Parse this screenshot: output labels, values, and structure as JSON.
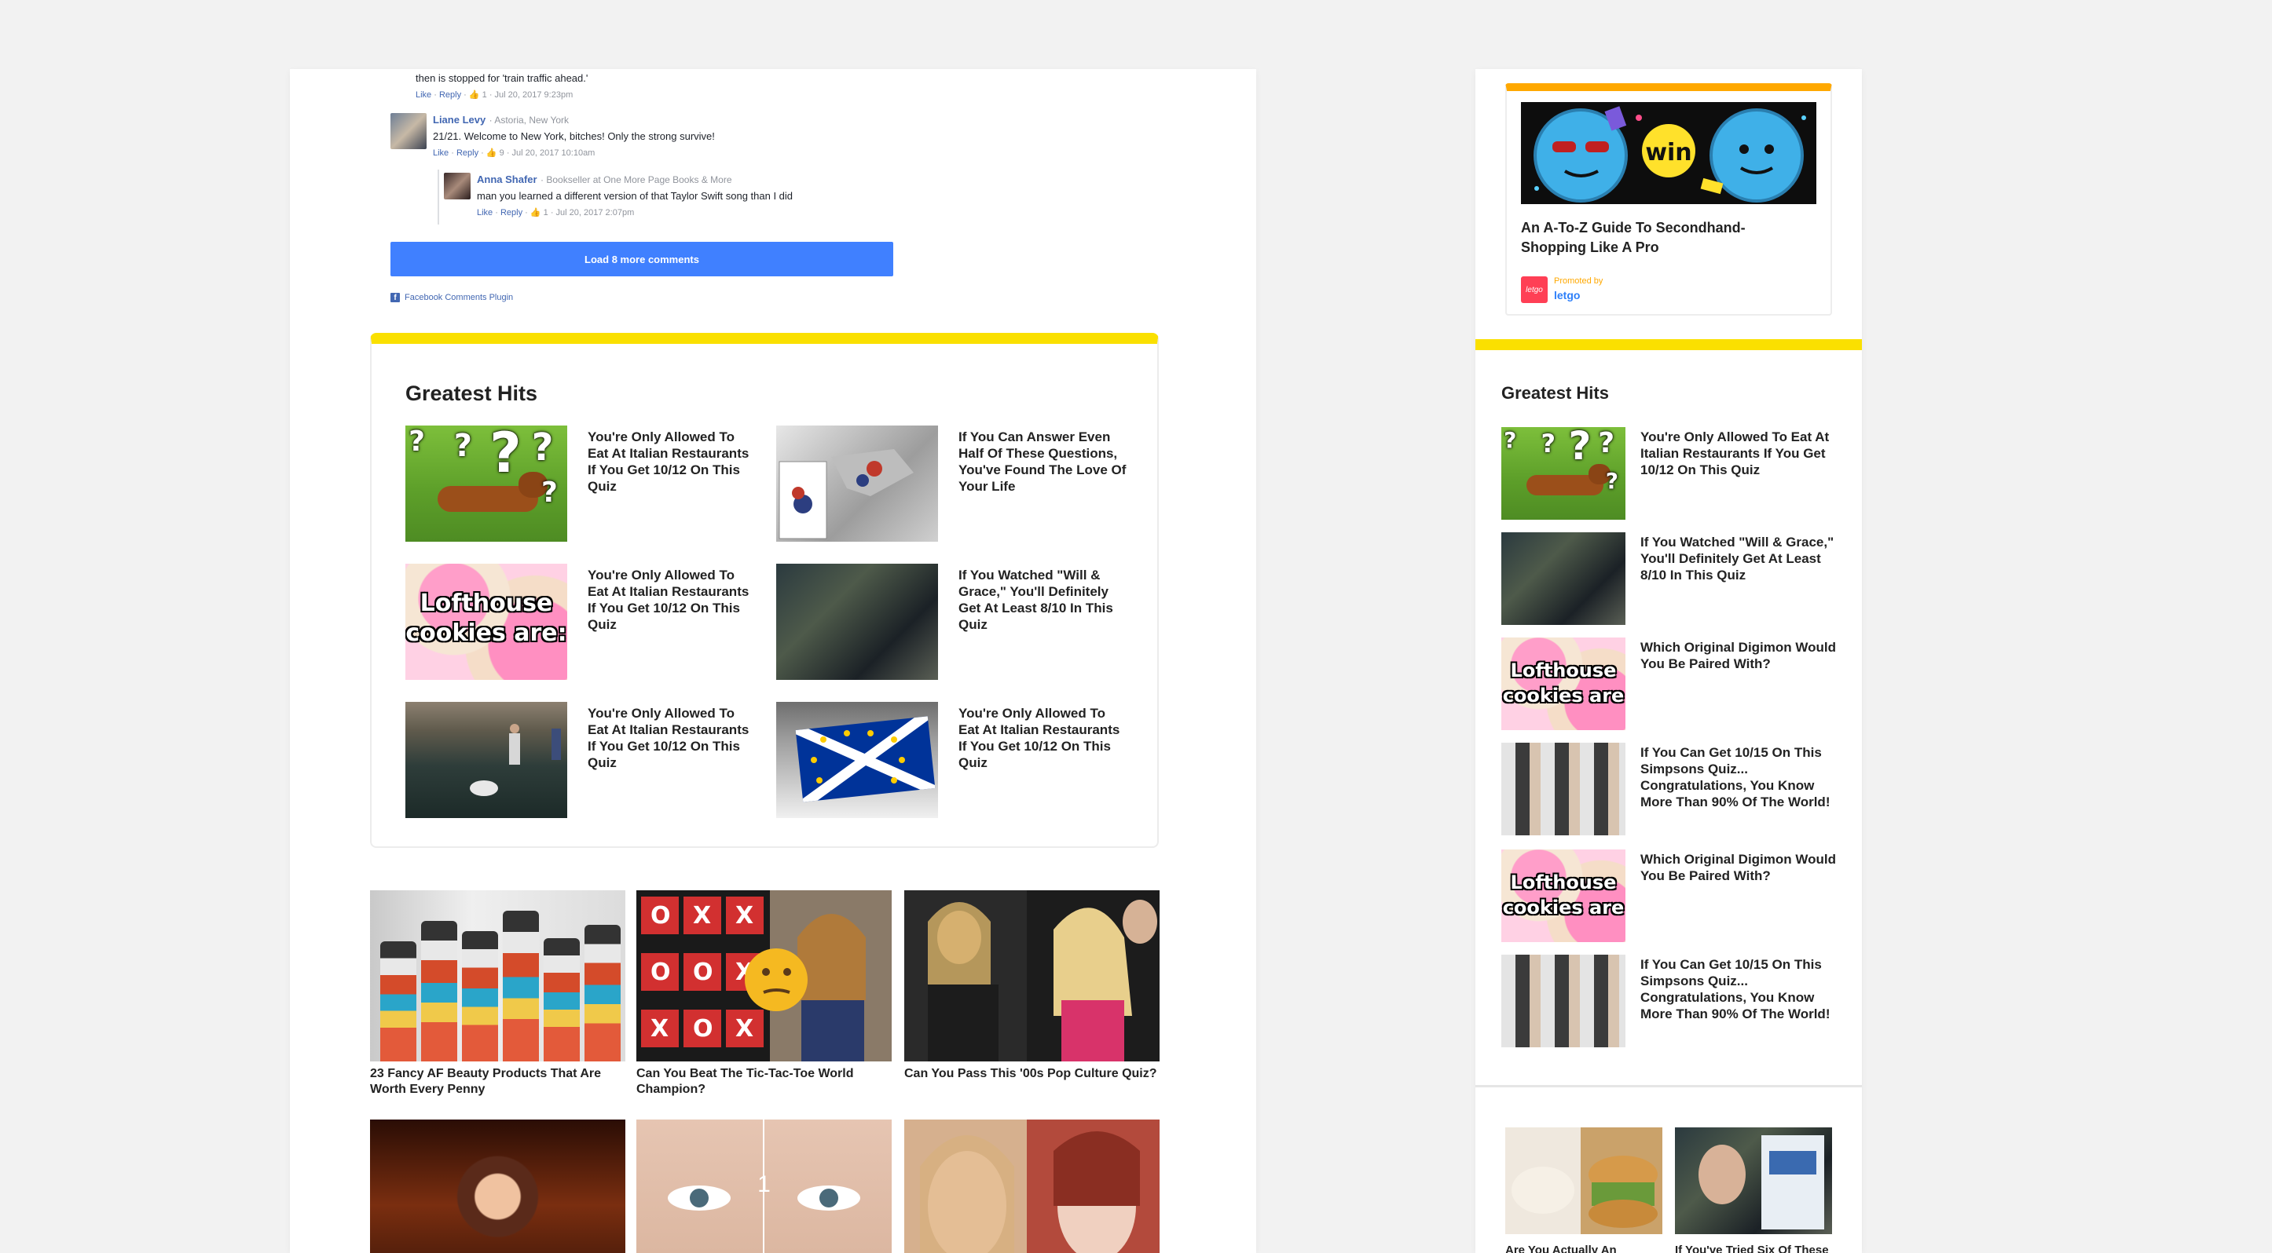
{
  "comments": {
    "top_fragment": {
      "text": "then is stopped for 'train traffic ahead.'",
      "meta": {
        "like": "Like",
        "reply": "Reply",
        "likes": "1",
        "time": "Jul 20, 2017 9:23pm"
      }
    },
    "liane": {
      "name": "Liane Levy",
      "location": "Astoria, New York",
      "text": "21/21. Welcome to New York, bitches! Only the strong survive!",
      "meta": {
        "like": "Like",
        "reply": "Reply",
        "likes": "9",
        "time": "Jul 20, 2017 10:10am"
      }
    },
    "anna": {
      "name": "Anna Shafer",
      "subtitle": "Bookseller at One More Page Books & More",
      "text": "man you learned a different version of that Taylor Swift song than I did",
      "meta": {
        "like": "Like",
        "reply": "Reply",
        "likes": "1",
        "time": "Jul 20, 2017 2:07pm"
      }
    },
    "load_more": "Load 8 more comments",
    "plugin_label": "Facebook Comments Plugin"
  },
  "greatest_hits": {
    "title": "Greatest Hits",
    "items": [
      {
        "label": "You're Only Allowed To Eat At Italian Restaurants If You Get 10/12 On This Quiz",
        "image": "dog-question-marks"
      },
      {
        "label": "If You Can Answer Even Half Of These Questions, You've Found The Love Of Your Life",
        "image": "robot-figure"
      },
      {
        "label": "You're Only Allowed To Eat At Italian Restaurants If You Get 10/12 On This Quiz",
        "image": "lofthouse-cookies"
      },
      {
        "label": "If You Watched \"Will & Grace,\" You'll Definitely Get At Least 8/10 In This Quiz",
        "image": "dark-forest-scene"
      },
      {
        "label": "You're Only Allowed To Eat At Italian Restaurants If You Get 10/12 On This Quiz",
        "image": "pool-photo"
      },
      {
        "label": "You're Only Allowed To Eat At Italian Restaurants If You Get 10/12 On This Quiz",
        "image": "eu-scotland-flag"
      }
    ],
    "cookie_overlay": "Lofthouse cookies are:"
  },
  "grid": [
    {
      "caption": "23 Fancy AF Beauty Products That Are Worth Every Penny"
    },
    {
      "caption": "Can You Beat The Tic-Tac-Toe World Champion?"
    },
    {
      "caption": "Can You Pass This '00s Pop Culture Quiz?"
    },
    {
      "caption": ""
    },
    {
      "caption": "",
      "overlay": "1"
    },
    {
      "caption": ""
    }
  ],
  "ttt": {
    "cells": [
      "O",
      "X",
      "X",
      "O",
      "O",
      "X",
      "X",
      "O",
      "X"
    ]
  },
  "sidebar": {
    "ad": {
      "image_text": "win",
      "title": "An A-To-Z Guide To Secondhand-Shopping Like A Pro",
      "promoted_label": "Promoted by",
      "brand": "letgo",
      "logo_text": "letgo"
    },
    "greatest_hits_title": "Greatest Hits",
    "items": [
      {
        "label": "You're Only Allowed To Eat At Italian Restaurants If You Get 10/12 On This Quiz"
      },
      {
        "label": "If You Watched \"Will & Grace,\" You'll Definitely Get At Least 8/10 In This Quiz"
      },
      {
        "label": "Which Original Digimon Would You Be Paired With?"
      },
      {
        "label": "If You Can Get 10/15 On This Simpsons Quiz... Congratulations, You Know More Than 90% Of The World!"
      },
      {
        "label": "Which Original Digimon Would You Be Paired With?"
      },
      {
        "label": "If You Can Get 10/15 On This Simpsons Quiz... Congratulations, You Know More Than 90% Of The World!"
      }
    ],
    "cookie_overlay": "Lofthouse cookies are",
    "bottom": [
      {
        "caption": "Are You Actually An"
      },
      {
        "caption": "If You've Tried Six Of These"
      }
    ]
  },
  "colors": {
    "yellow": "#fae000",
    "orange": "#ffa800",
    "fb_blue": "#4267b2",
    "button_blue": "#4080ff"
  }
}
